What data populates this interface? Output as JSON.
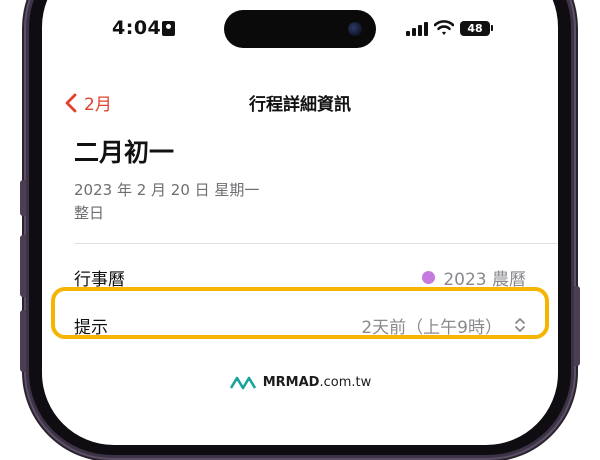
{
  "status_bar": {
    "time": "4:04",
    "battery": "48"
  },
  "nav": {
    "back_label": "2月",
    "title": "行程詳細資訊"
  },
  "event": {
    "title": "二月初一",
    "date": "2023 年 2 月 20 日 星期一",
    "all_day": "整日"
  },
  "rows": {
    "calendar": {
      "label": "行事曆",
      "value": "2023 農曆",
      "dot_color": "#c47ae0"
    },
    "alert": {
      "label": "提示",
      "value": "2天前（上午9時）"
    }
  },
  "watermark": {
    "brand": "MRMAD",
    "suffix": ".com.tw"
  },
  "colors": {
    "accent": "#e0402c",
    "highlight": "#f4b400"
  }
}
